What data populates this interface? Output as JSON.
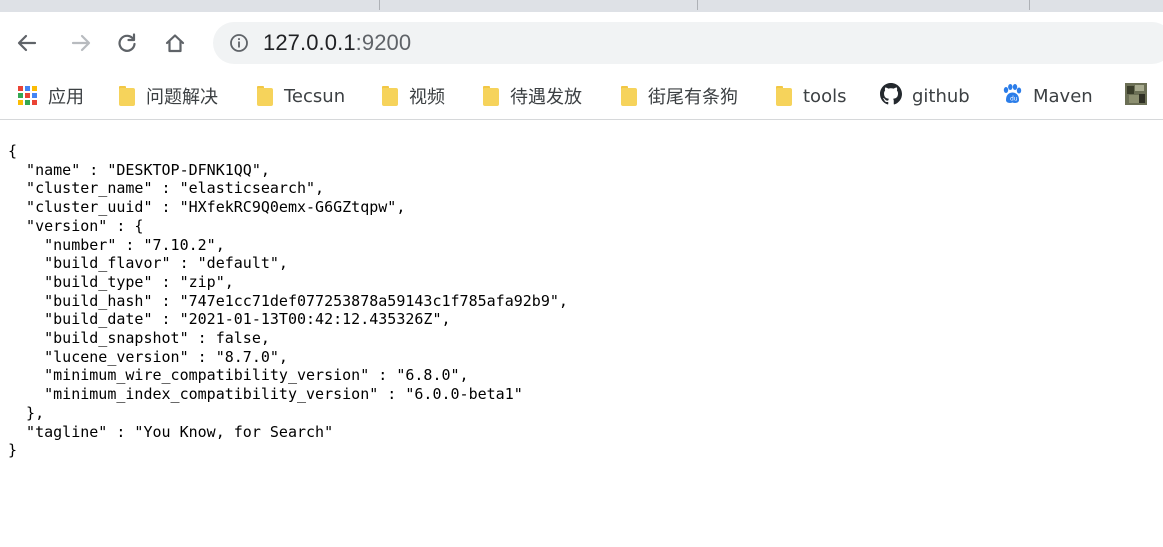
{
  "browser": {
    "address_bar": {
      "host": "127.0.0.1",
      "port": ":9200"
    },
    "icons": {
      "back": "arrow-left-icon",
      "forward": "arrow-right-icon",
      "reload": "reload-icon",
      "home": "home-icon",
      "info": "info-icon"
    },
    "bookmarks": [
      {
        "label": "应用",
        "icon": "apps-grid-icon"
      },
      {
        "label": "问题解决",
        "icon": "folder-icon"
      },
      {
        "label": "Tecsun",
        "icon": "folder-icon"
      },
      {
        "label": "视频",
        "icon": "folder-icon"
      },
      {
        "label": "待遇发放",
        "icon": "folder-icon"
      },
      {
        "label": "街尾有条狗",
        "icon": "folder-icon"
      },
      {
        "label": "tools",
        "icon": "folder-icon"
      },
      {
        "label": "github",
        "icon": "github-icon"
      },
      {
        "label": "Maven",
        "icon": "paw-icon"
      },
      {
        "label": "",
        "icon": "thumbnail-icon"
      }
    ]
  },
  "page": {
    "json_text": "{\n  \"name\" : \"DESKTOP-DFNK1QQ\",\n  \"cluster_name\" : \"elasticsearch\",\n  \"cluster_uuid\" : \"HXfekRC9Q0emx-G6GZtqpw\",\n  \"version\" : {\n    \"number\" : \"7.10.2\",\n    \"build_flavor\" : \"default\",\n    \"build_type\" : \"zip\",\n    \"build_hash\" : \"747e1cc71def077253878a59143c1f785afa92b9\",\n    \"build_date\" : \"2021-01-13T00:42:12.435326Z\",\n    \"build_snapshot\" : false,\n    \"lucene_version\" : \"8.7.0\",\n    \"minimum_wire_compatibility_version\" : \"6.8.0\",\n    \"minimum_index_compatibility_version\" : \"6.0.0-beta1\"\n  },\n  \"tagline\" : \"You Know, for Search\"\n}"
  },
  "colors": {
    "folder": "#f6d35b",
    "tabstrip": "#dee1e6",
    "omnibox": "#f1f3f4",
    "maven_paw": "#2b7de9"
  }
}
